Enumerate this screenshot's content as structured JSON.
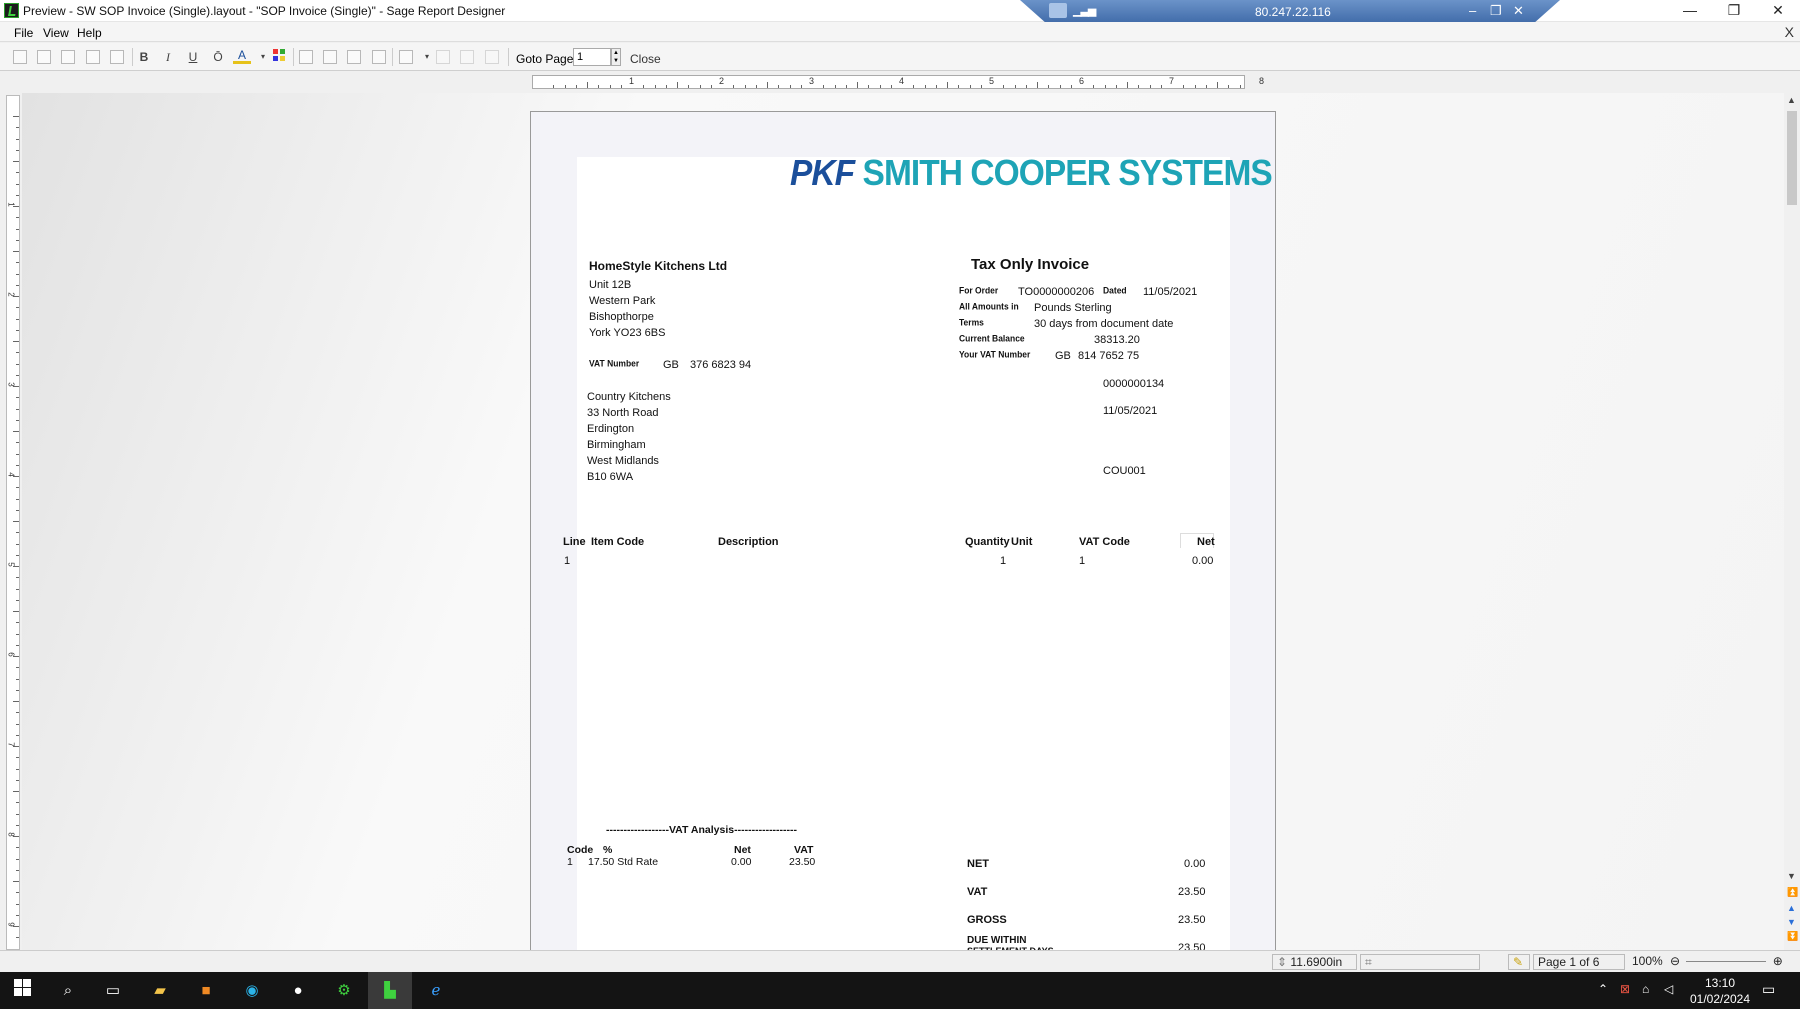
{
  "window": {
    "title": "Preview - SW SOP Invoice (Single).layout - \"SOP Invoice (Single)\" - Sage Report Designer",
    "minimize": "—",
    "restore": "❐",
    "close": "✕"
  },
  "rdp": {
    "ip": "80.247.22.116",
    "signal": "▁▃▅",
    "min": "–",
    "restore": "❐",
    "close": "✕"
  },
  "menu": {
    "file": "File",
    "view": "View",
    "help": "Help",
    "close_x": "X"
  },
  "toolbar": {
    "bold": "B",
    "italic": "I",
    "underline": "U",
    "overline": "Ō",
    "font_color": "A",
    "goto_label": "Goto Page",
    "goto_value": "1",
    "close_label": "Close"
  },
  "ruler": {
    "h_numbers": [
      "1",
      "2",
      "3",
      "4",
      "5",
      "6",
      "7",
      "8"
    ],
    "v_numbers": [
      "1",
      "2",
      "3",
      "4",
      "5",
      "6",
      "7",
      "8",
      "9"
    ]
  },
  "invoice": {
    "logo_pkf": "PKF",
    "logo_rest": "SMITH COOPER SYSTEMS",
    "title": "Tax Only Invoice",
    "company": {
      "name": "HomeStyle Kitchens Ltd",
      "address": [
        "Unit 12B",
        "Western Park",
        "Bishopthorpe",
        "York YO23 6BS"
      ],
      "vat_label": "VAT Number",
      "vat_prefix": "GB",
      "vat_number": "376 6823 94"
    },
    "meta": {
      "for_order_label": "For Order",
      "for_order": "TO0000000206",
      "dated_label": "Dated",
      "dated": "11/05/2021",
      "amounts_label": "All Amounts in",
      "amounts": "Pounds Sterling",
      "terms_label": "Terms",
      "terms": "30 days from document date",
      "balance_label": "Current Balance",
      "balance": "38313.20",
      "your_vat_label": "Your VAT Number",
      "your_vat_prefix": "GB",
      "your_vat": "814 7652 75",
      "invoice_no": "0000000134",
      "invoice_date": "11/05/2021",
      "account_ref": "COU001"
    },
    "customer": {
      "lines": [
        "Country Kitchens",
        "33 North Road",
        "Erdington",
        "Birmingham",
        "West Midlands",
        "B10 6WA"
      ]
    },
    "columns": {
      "line": "Line",
      "item_code": "Item Code",
      "description": "Description",
      "quantity": "Quantity",
      "unit": "Unit",
      "vat_code": "VAT Code",
      "net": "Net"
    },
    "rows": [
      {
        "line": "1",
        "quantity": "1",
        "vat_code": "1",
        "net": "0.00"
      }
    ],
    "vat_analysis": {
      "heading": "------------------VAT Analysis------------------",
      "col_code": "Code",
      "col_pct": "%",
      "col_net": "Net",
      "col_vat": "VAT",
      "row_code": "1",
      "row_rate": "17.50 Std Rate",
      "row_net": "0.00",
      "row_vat": "23.50"
    },
    "totals": {
      "net_label": "NET",
      "net": "0.00",
      "vat_label": "VAT",
      "vat": "23.50",
      "gross_label": "GROSS",
      "gross": "23.50",
      "due_label": "DUE WITHIN",
      "due_sub": "SETTLEMENT DAYS",
      "due": "23.50"
    }
  },
  "status": {
    "height": "11.6900in",
    "page": "Page 1 of 6",
    "zoom": "100%"
  },
  "taskbar": {
    "time": "13:10",
    "date": "01/02/2024"
  }
}
